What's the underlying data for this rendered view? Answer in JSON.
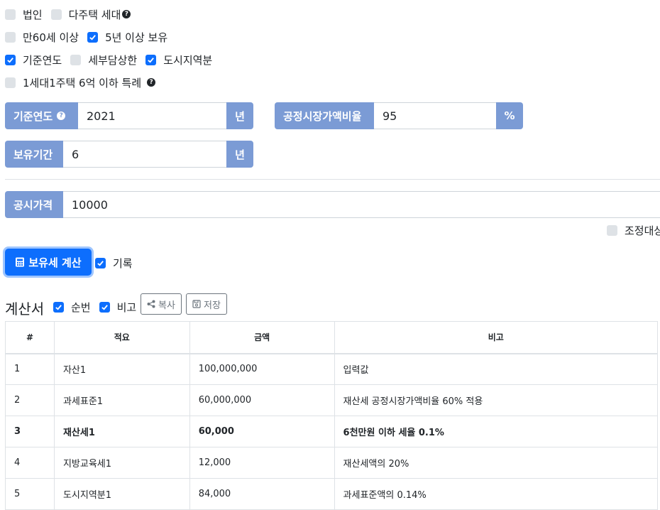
{
  "options": {
    "corp": "법인",
    "multi_house": "다주택 세대",
    "age60": "만60세 이상",
    "own5": "5년 이상 보유",
    "base_year": "기준연도",
    "tax_cap": "세부담상한",
    "urban": "도시지역분",
    "one_house": "1세대1주택 6억 이하 특례"
  },
  "form": {
    "base_year_label": "기준연도",
    "base_year_value": "2021",
    "year_unit": "년",
    "fmv_label": "공정시장가액비율",
    "fmv_value": "95",
    "percent_unit": "%",
    "holding_label": "보유기간",
    "holding_value": "6",
    "holding_unit": "년",
    "price_label": "공시가격",
    "price_value": "10000",
    "adjust_label": "조정대상"
  },
  "actions": {
    "calc_label": "보유세 계산",
    "record_label": "기록"
  },
  "sheet": {
    "title": "계산서",
    "order_label": "순번",
    "note_label": "비고",
    "copy_label": "복사",
    "save_label": "저장"
  },
  "table": {
    "headers": [
      "#",
      "적요",
      "금액",
      "비고"
    ],
    "rows": [
      [
        "1",
        "자산1",
        "100,000,000",
        "입력값"
      ],
      [
        "2",
        "과세표준1",
        "60,000,000",
        "재산세 공정시장가액비율 60% 적용"
      ],
      [
        "3",
        "재산세1",
        "60,000",
        "6천만원 이하 세율 0.1%"
      ],
      [
        "4",
        "지방교육세1",
        "12,000",
        "재산세액의 20%"
      ],
      [
        "5",
        "도시지역분1",
        "84,000",
        "과세표준액의 0.14%"
      ]
    ]
  },
  "colors": {
    "primary": "#0d6efd",
    "addon": "#7b9bd5"
  }
}
